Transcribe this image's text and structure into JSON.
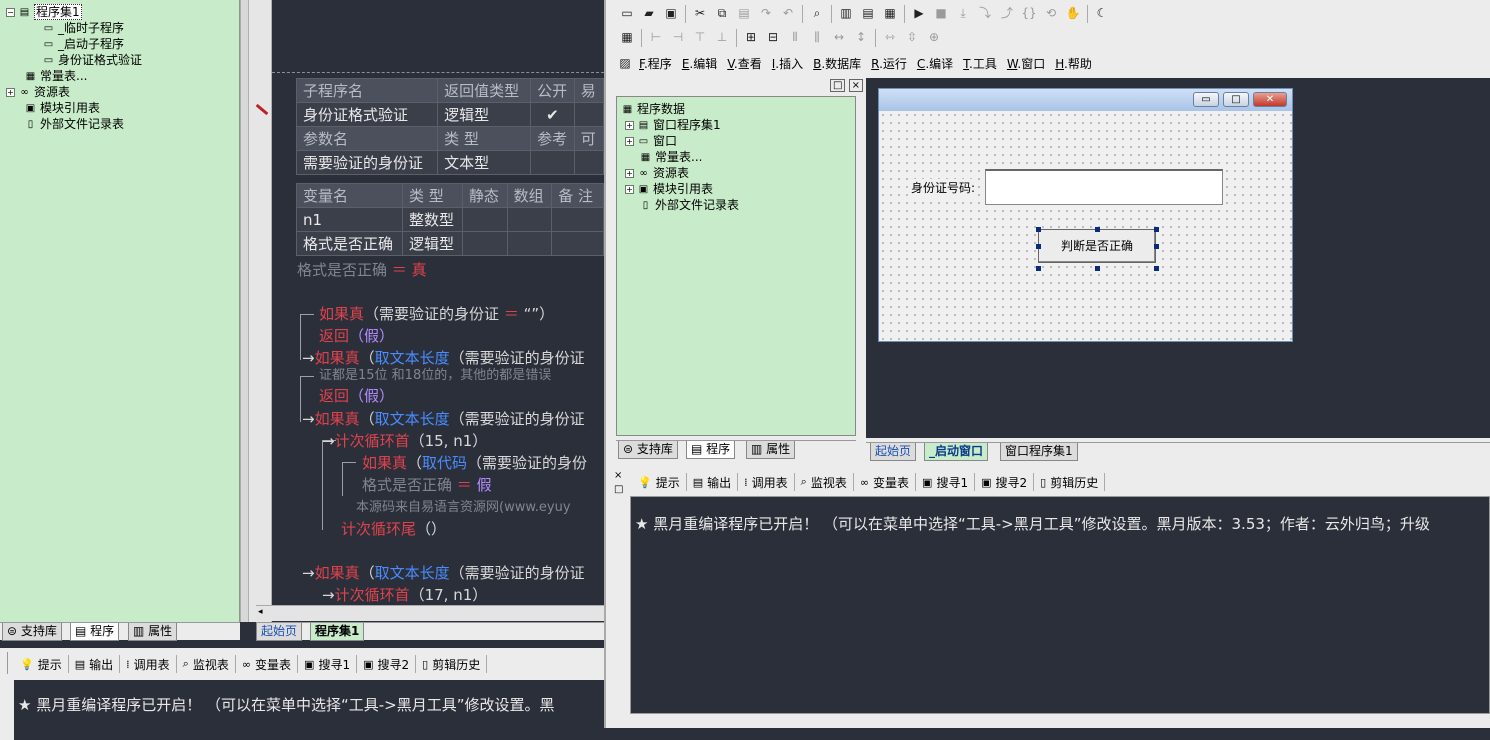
{
  "left_tree": {
    "items": [
      {
        "label": "程序集1",
        "indent": 1
      },
      {
        "label": "_临时子程序",
        "indent": 3
      },
      {
        "label": "_启动子程序",
        "indent": 3
      },
      {
        "label": "身份证格式验证",
        "indent": 3
      },
      {
        "label": "常量表...",
        "indent": 2
      },
      {
        "label": "资源表",
        "indent": 1
      },
      {
        "label": "模块引用表",
        "indent": 2
      },
      {
        "label": "外部文件记录表",
        "indent": 2
      }
    ],
    "tabs": [
      "支持库",
      "程序",
      "属性"
    ]
  },
  "editor": {
    "sub_table": {
      "headers": [
        "子程序名",
        "返回值类型",
        "公开",
        "易"
      ],
      "row": [
        "身份证格式验证",
        "逻辑型",
        "✔",
        ""
      ]
    },
    "param_table": {
      "headers": [
        "参数名",
        "类 型",
        "参考",
        "可"
      ],
      "row": [
        "需要验证的身份证",
        "文本型",
        "",
        ""
      ]
    },
    "var_table": {
      "headers": [
        "变量名",
        "类 型",
        "静态",
        "数组",
        "备 注"
      ],
      "rows": [
        [
          "n1",
          "整数型",
          "",
          "",
          ""
        ],
        [
          "格式是否正确",
          "逻辑型",
          "",
          "",
          ""
        ]
      ]
    },
    "lines": {
      "assign_var": "格式是否正确",
      "assign_op": "＝",
      "assign_val": "真",
      "if_kw": "如果真",
      "if1_rest": "（需要验证的身份证",
      "if1_op": "＝",
      "if1_tail": "“”）",
      "return_kw": "返回",
      "return_arg": "（假）",
      "len_fn": "取文本长度",
      "paren_open": "（",
      "if2_tail": "（需要验证的身份证",
      "comment1": "证都是15位 和18位的，其他的都是错误",
      "loop_kw": "计次循环首",
      "loop1_args": "（15, n1）",
      "code_fn": "取代码",
      "if4_tail": "（需要验证的身份",
      "assign2_op": "＝",
      "assign2_val": "假",
      "comment2": "本源码来自易语言资源网(www.eyuy",
      "loop_end": "计次循环尾",
      "loop_end_args": "（）",
      "loop2_args": "（17, n1）"
    },
    "tabs": [
      "起始页",
      "程序集1"
    ]
  },
  "bottom_left": {
    "toolbar": [
      "提示",
      "输出",
      "调用表",
      "监视表",
      "变量表",
      "搜寻1",
      "搜寻2",
      "剪辑历史"
    ],
    "message": "★ 黑月重编译程序已开启！  （可以在菜单中选择“工具->黑月工具”修改设置。黑"
  },
  "right": {
    "menu": [
      {
        "key": "F",
        "label": ".程序"
      },
      {
        "key": "E",
        "label": ".编辑"
      },
      {
        "key": "V",
        "label": ".查看"
      },
      {
        "key": "I",
        "label": ".插入"
      },
      {
        "key": "B",
        "label": ".数据库"
      },
      {
        "key": "R",
        "label": ".运行"
      },
      {
        "key": "C",
        "label": ".编译"
      },
      {
        "key": "T",
        "label": ".工具"
      },
      {
        "key": "W",
        "label": ".窗口"
      },
      {
        "key": "H",
        "label": ".帮助"
      }
    ],
    "tree": {
      "items": [
        {
          "label": "程序数据",
          "indent": 0
        },
        {
          "label": "窗口程序集1",
          "indent": 1
        },
        {
          "label": "窗口",
          "indent": 1
        },
        {
          "label": "常量表...",
          "indent": 2
        },
        {
          "label": "资源表",
          "indent": 1
        },
        {
          "label": "模块引用表",
          "indent": 1
        },
        {
          "label": "外部文件记录表",
          "indent": 2
        }
      ],
      "tabs": [
        "支持库",
        "程序",
        "属性"
      ]
    },
    "form": {
      "label": "身份证号码:",
      "input_value": "",
      "button": "判断是否正确"
    },
    "designer_tabs": [
      "起始页",
      "_启动窗口",
      "窗口程序集1"
    ],
    "output_toolbar": [
      "提示",
      "输出",
      "调用表",
      "监视表",
      "变量表",
      "搜寻1",
      "搜寻2",
      "剪辑历史"
    ],
    "message": "★ 黑月重编译程序已开启！  （可以在菜单中选择“工具->黑月工具”修改设置。黑月版本：3.53；作者：云外归鸟；升级"
  }
}
